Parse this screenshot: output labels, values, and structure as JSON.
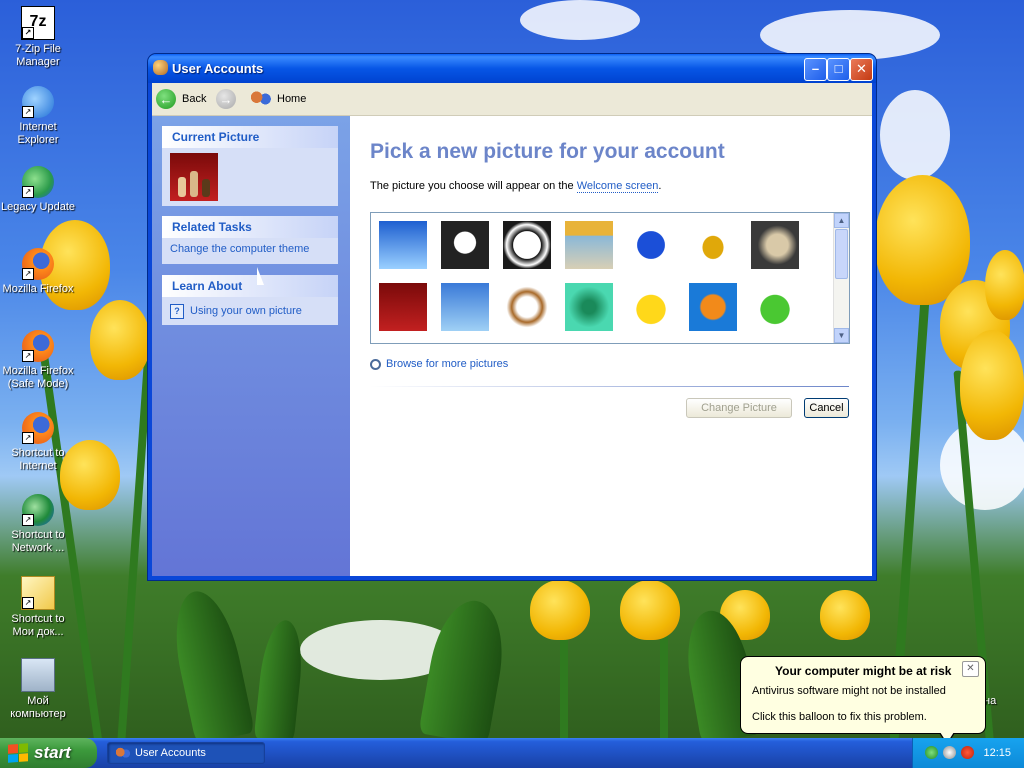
{
  "desktop": {
    "icons": [
      {
        "label": "7-Zip File Manager",
        "icon": "7zip-icon"
      },
      {
        "label": "Internet Explorer",
        "icon": "internet-explorer-icon"
      },
      {
        "label": "Legacy Update",
        "icon": "legacy-update-icon"
      },
      {
        "label": "Mozilla Firefox",
        "icon": "firefox-icon"
      },
      {
        "label": "Mozilla Firefox (Safe Mode)",
        "icon": "firefox-icon"
      },
      {
        "label": "Shortcut to Internet",
        "icon": "firefox-icon"
      },
      {
        "label": "Shortcut to Network ...",
        "icon": "network-icon"
      },
      {
        "label": "Shortcut to Мои док...",
        "icon": "my-documents-icon"
      },
      {
        "label": "Мой компьютер",
        "icon": "my-computer-icon"
      }
    ],
    "partial_text": "на"
  },
  "window": {
    "title": "User Accounts",
    "toolbar": {
      "back": "Back",
      "home": "Home"
    },
    "left": {
      "current_picture": "Current Picture",
      "related_tasks": "Related Tasks",
      "related_task_1": "Change the computer theme",
      "learn_about": "Learn About",
      "learn_1": "Using your own picture"
    },
    "main": {
      "heading": "Pick a new picture for your account",
      "desc_prefix": "The picture you choose will appear on the ",
      "desc_link": "Welcome screen",
      "desc_suffix": ".",
      "pictures": [
        "airplane",
        "astronaut",
        "soccer ball",
        "beach chairs",
        "butterfly",
        "car",
        "owl",
        "chess",
        "dirt bike",
        "dog",
        "fish",
        "rubber duck",
        "fish",
        "frog"
      ],
      "browse": "Browse for more pictures",
      "change_button": "Change Picture",
      "cancel_button": "Cancel"
    }
  },
  "taskbar": {
    "start": "start",
    "task": "User Accounts",
    "time": "12:15"
  },
  "balloon": {
    "title": "Your computer might be at risk",
    "line1": "Antivirus software might not be installed",
    "line2": "Click this balloon to fix this problem."
  }
}
